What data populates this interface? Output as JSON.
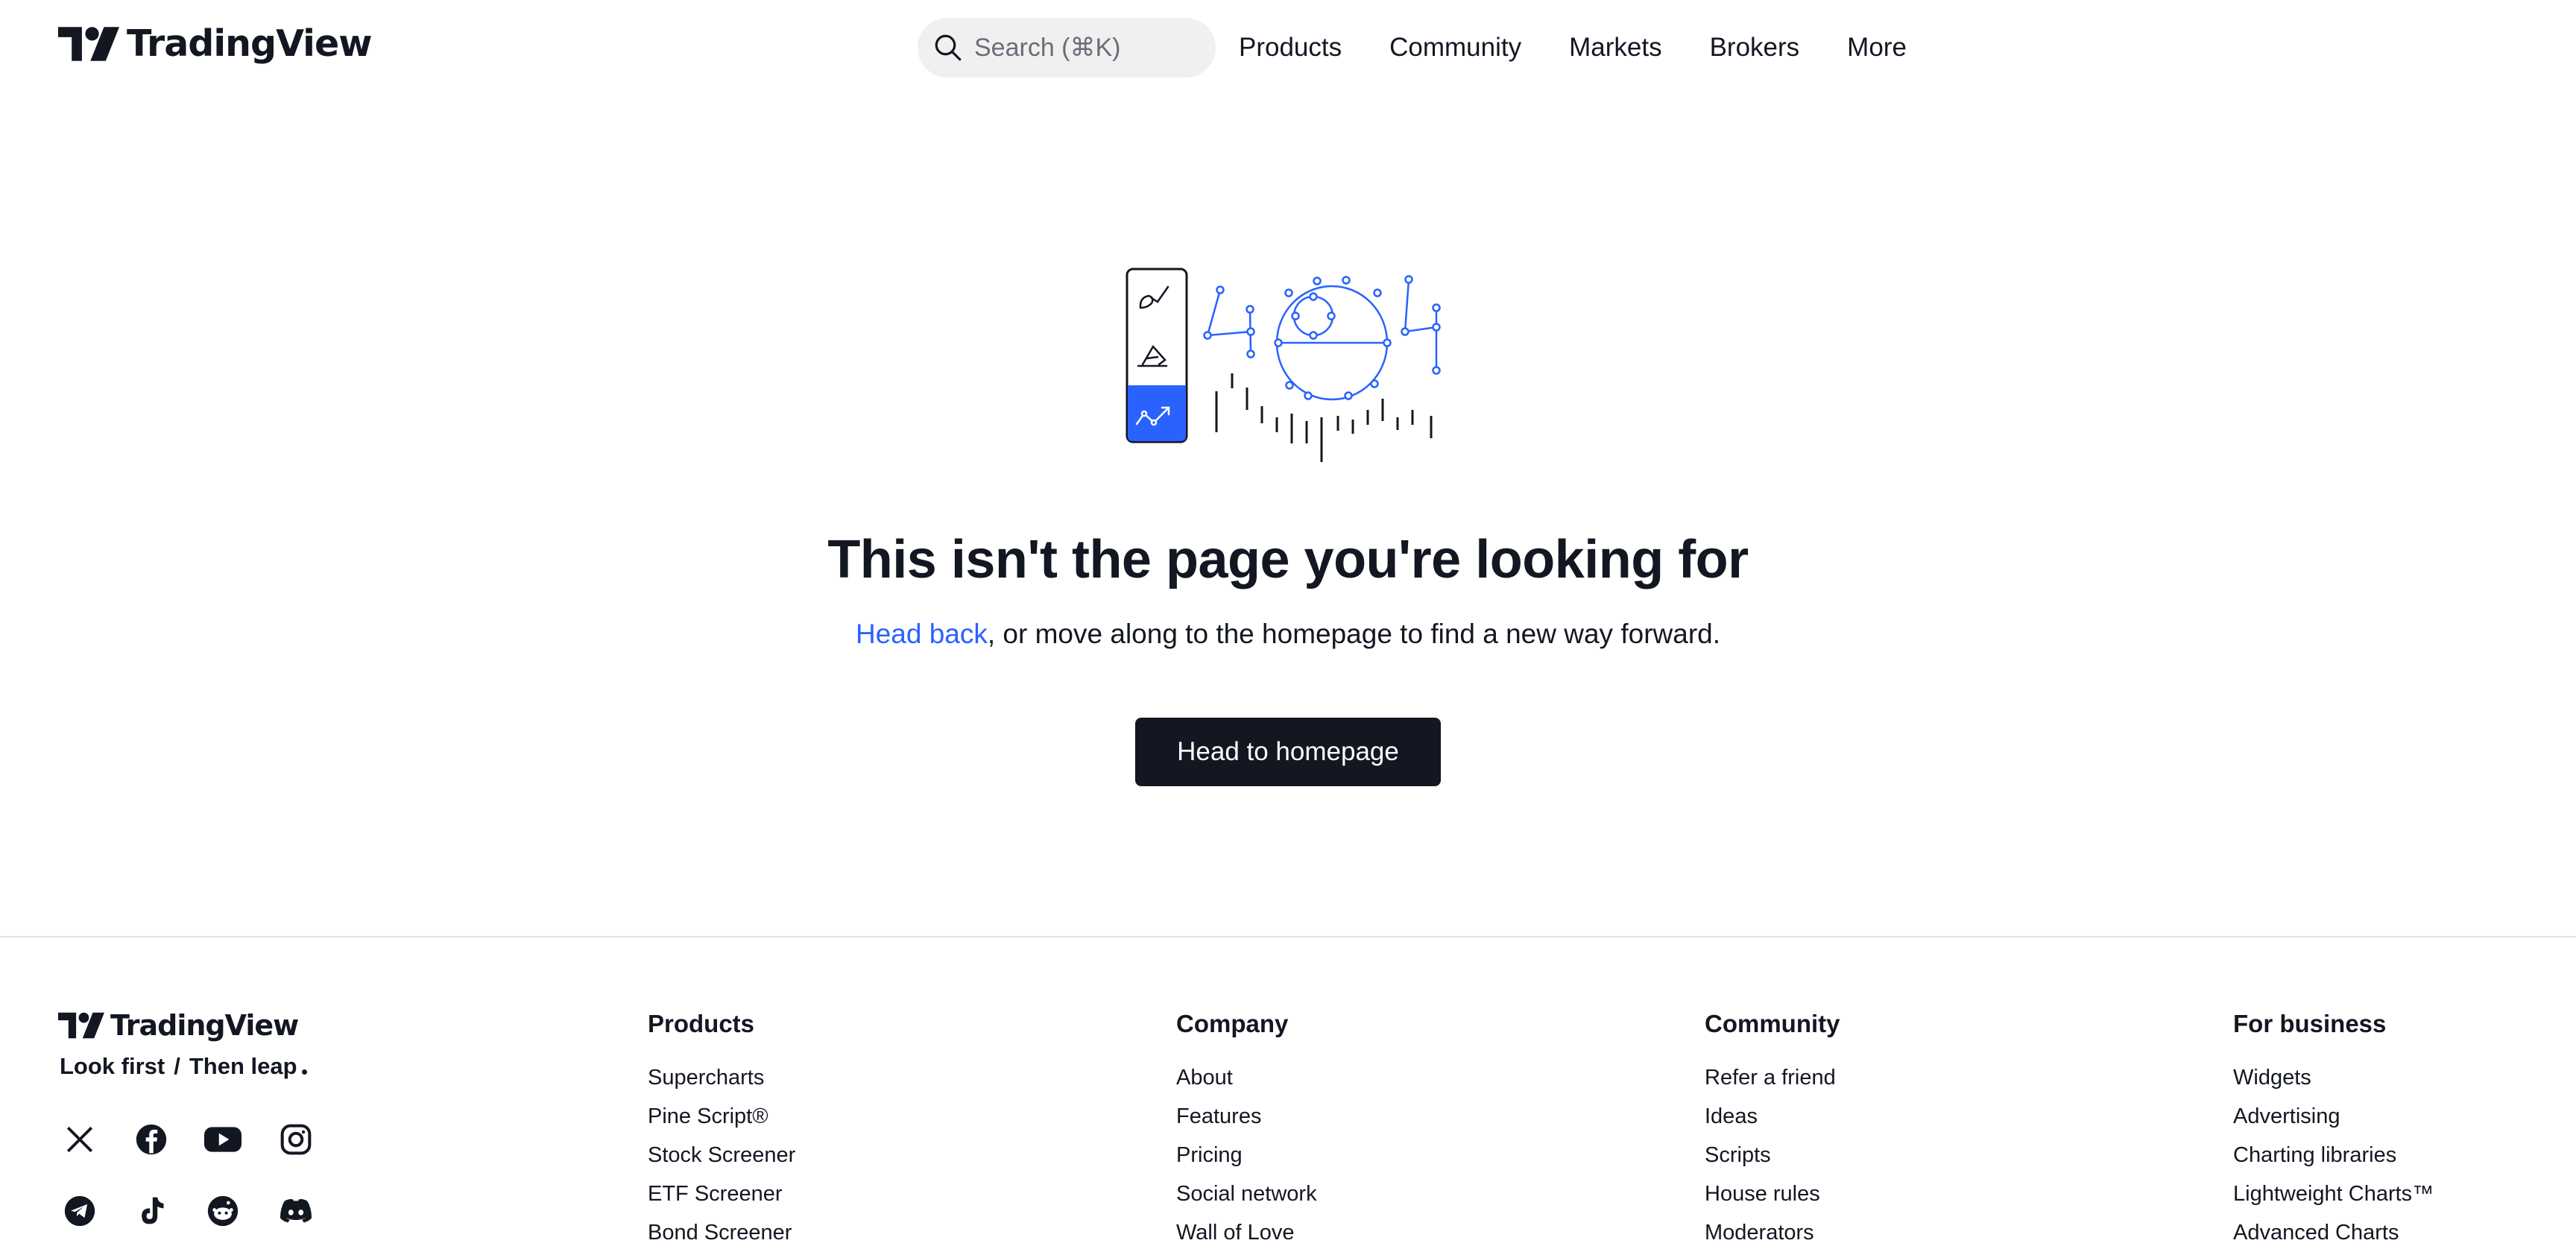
{
  "header": {
    "brand": "TradingView",
    "search_placeholder": "Search (⌘K)",
    "nav": [
      "Products",
      "Community",
      "Markets",
      "Brokers",
      "More"
    ]
  },
  "main": {
    "title": "This isn't the page you're looking for",
    "link_text": "Head back",
    "sub_text": ", or move along to the homepage to find a new way forward.",
    "cta_label": "Head to homepage"
  },
  "footer": {
    "brand": "TradingView",
    "tagline_left": "Look first",
    "tagline_sep": "/",
    "tagline_right": "Then leap",
    "social_icons": [
      "x-icon",
      "facebook-icon",
      "youtube-icon",
      "instagram-icon",
      "telegram-icon",
      "tiktok-icon",
      "reddit-icon",
      "discord-icon"
    ],
    "columns": [
      {
        "title": "Products",
        "links": [
          "Supercharts",
          "Pine Script®",
          "Stock Screener",
          "ETF Screener",
          "Bond Screener"
        ]
      },
      {
        "title": "Company",
        "links": [
          "About",
          "Features",
          "Pricing",
          "Social network",
          "Wall of Love"
        ]
      },
      {
        "title": "Community",
        "links": [
          "Refer a friend",
          "Ideas",
          "Scripts",
          "House rules",
          "Moderators"
        ]
      },
      {
        "title": "For business",
        "links": [
          "Widgets",
          "Advertising",
          "Charting libraries",
          "Lightweight Charts™",
          "Advanced Charts"
        ]
      }
    ]
  },
  "colors": {
    "accent": "#2962ff",
    "text": "#131722",
    "button_bg": "#131722",
    "search_bg": "#f0f0f0"
  }
}
